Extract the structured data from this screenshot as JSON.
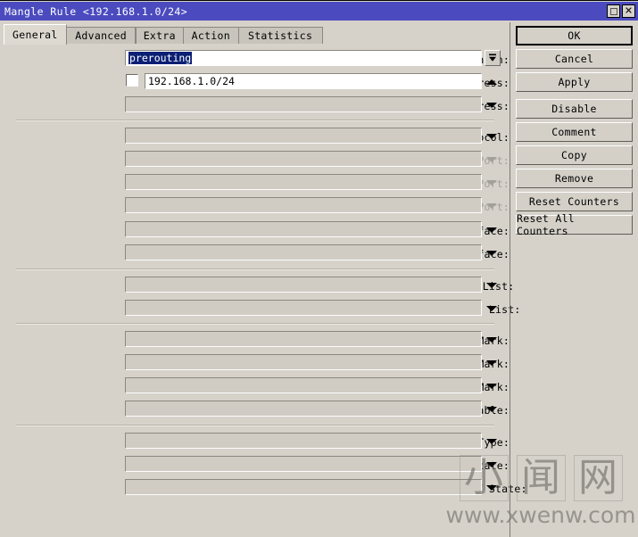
{
  "window": {
    "title": "Mangle Rule <192.168.1.0/24>",
    "maximize_icon": "maximize-icon",
    "close_icon": "close-icon",
    "close_glyph": "✕"
  },
  "tabs": [
    {
      "label": "General",
      "active": true
    },
    {
      "label": "Advanced",
      "active": false
    },
    {
      "label": "Extra",
      "active": false
    },
    {
      "label": "Action",
      "active": false
    },
    {
      "label": "Statistics",
      "active": false
    }
  ],
  "form": {
    "rows": [
      {
        "label": "Chain:",
        "value": "prerouting",
        "selected": true,
        "disabled": false,
        "control": "combo",
        "checkbox": false,
        "white": true
      },
      {
        "label": "Src. Address:",
        "value": "192.168.1.0/24",
        "selected": false,
        "disabled": false,
        "control": "up",
        "checkbox": true,
        "white": true
      },
      {
        "label": "Dst. Address:",
        "value": "",
        "selected": false,
        "disabled": false,
        "control": "down",
        "checkbox": false,
        "white": false
      },
      {
        "label": "Protocol:",
        "value": "",
        "selected": false,
        "disabled": false,
        "control": "down",
        "checkbox": false,
        "white": false
      },
      {
        "label": "Src. Port:",
        "value": "",
        "selected": false,
        "disabled": true,
        "control": "downdim",
        "checkbox": false,
        "white": false
      },
      {
        "label": "Dst. Port:",
        "value": "",
        "selected": false,
        "disabled": true,
        "control": "downdim",
        "checkbox": false,
        "white": false
      },
      {
        "label": "Any. Port:",
        "value": "",
        "selected": false,
        "disabled": true,
        "control": "downdim",
        "checkbox": false,
        "white": false
      },
      {
        "label": "In. Interface:",
        "value": "",
        "selected": false,
        "disabled": false,
        "control": "down",
        "checkbox": false,
        "white": false
      },
      {
        "label": "Out. Interface:",
        "value": "",
        "selected": false,
        "disabled": false,
        "control": "down",
        "checkbox": false,
        "white": false
      },
      {
        "label": "In. Interface List:",
        "value": "",
        "selected": false,
        "disabled": false,
        "control": "down",
        "checkbox": false,
        "white": false
      },
      {
        "label": "Out. Interface List:",
        "value": "",
        "selected": false,
        "disabled": false,
        "control": "down",
        "checkbox": false,
        "white": false
      },
      {
        "label": "Packet Mark:",
        "value": "",
        "selected": false,
        "disabled": false,
        "control": "down",
        "checkbox": false,
        "white": false
      },
      {
        "label": "Connection Mark:",
        "value": "",
        "selected": false,
        "disabled": false,
        "control": "down",
        "checkbox": false,
        "white": false
      },
      {
        "label": "Routing Mark:",
        "value": "",
        "selected": false,
        "disabled": false,
        "control": "down",
        "checkbox": false,
        "white": false
      },
      {
        "label": "Routing Table:",
        "value": "",
        "selected": false,
        "disabled": false,
        "control": "down",
        "checkbox": false,
        "white": false
      },
      {
        "label": "Connection Type:",
        "value": "",
        "selected": false,
        "disabled": false,
        "control": "down",
        "checkbox": false,
        "white": false
      },
      {
        "label": "Connection State:",
        "value": "",
        "selected": false,
        "disabled": false,
        "control": "down",
        "checkbox": false,
        "white": false
      },
      {
        "label": "Connection NAT State:",
        "value": "",
        "selected": false,
        "disabled": false,
        "control": "down",
        "checkbox": false,
        "white": false
      }
    ]
  },
  "buttons": [
    {
      "label": "OK",
      "focused": true,
      "gap": false
    },
    {
      "label": "Cancel",
      "focused": false,
      "gap": false
    },
    {
      "label": "Apply",
      "focused": false,
      "gap": false
    },
    {
      "label": "Disable",
      "focused": false,
      "gap": true
    },
    {
      "label": "Comment",
      "focused": false,
      "gap": false
    },
    {
      "label": "Copy",
      "focused": false,
      "gap": false
    },
    {
      "label": "Remove",
      "focused": false,
      "gap": false
    },
    {
      "label": "Reset Counters",
      "focused": false,
      "gap": false
    },
    {
      "label": "Reset All Counters",
      "focused": false,
      "gap": false
    }
  ],
  "watermark": {
    "chars": [
      "小",
      "闻",
      "网"
    ],
    "url": "www.xwenw.com"
  },
  "colors": {
    "titlebar": "#4b4bbf",
    "dialog_bg": "#d6d2ca",
    "field_bg": "#d0ccc4",
    "selection": "#0b1f73",
    "disabled_text": "#a3a09a"
  }
}
